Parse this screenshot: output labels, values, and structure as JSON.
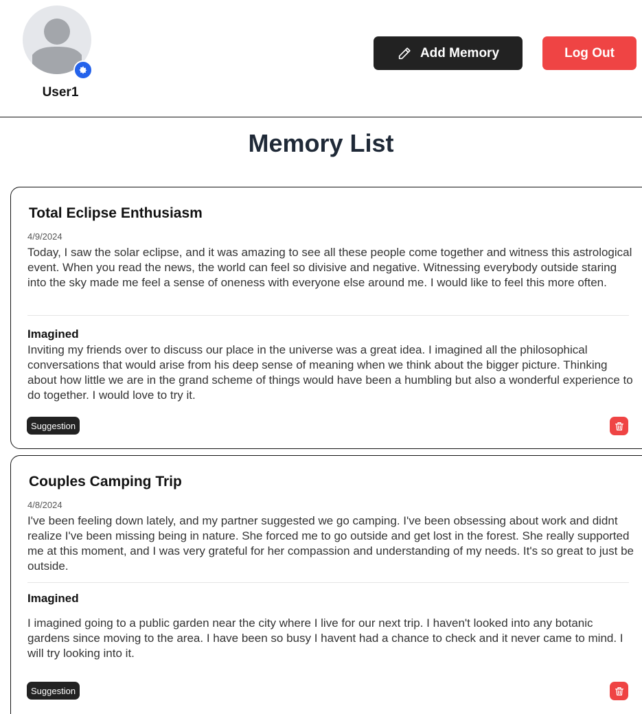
{
  "user": {
    "name": "User1"
  },
  "header": {
    "add_memory_label": "Add Memory",
    "logout_label": "Log Out"
  },
  "page": {
    "title": "Memory List"
  },
  "colors": {
    "accent_dark": "#222222",
    "danger": "#ef4444",
    "settings_badge": "#2563eb"
  },
  "memories": [
    {
      "title": "Total Eclipse Enthusiasm",
      "date": "4/9/2024",
      "text": "Today, I saw the solar eclipse, and it was amazing to see all these people come together and witness this astrological event. When you read the news, the world can feel so divisive and negative. Witnessing everybody outside staring into the sky made me feel a sense of oneness with everyone else around me. I would like to feel this more often.",
      "imagined_label": "Imagined",
      "imagined_text": "Inviting my friends over to discuss our place in the universe was a great idea. I imagined all the philosophical conversations that would arise from his deep sense of meaning when we think about the bigger picture. Thinking about how little we are in the grand scheme of things would have been a humbling but also a wonderful experience to do together. I would love to try it.",
      "tag": "Suggestion"
    },
    {
      "title": "Couples Camping Trip",
      "date": "4/8/2024",
      "text": "I've been feeling down lately, and my partner suggested we go camping. I've been obsessing about work and didnt realize I've been missing being in nature. She forced me to go outside and get lost in the forest. She really supported me at this moment, and I was very grateful for her compassion and understanding of my needs. It's so great to just be outside.",
      "imagined_label": "Imagined",
      "imagined_text": "I imagined going to a public garden near the city where I live for our next trip. I haven't looked into any botanic gardens since moving to the area. I have been so busy I havent had a chance to check and it never came to mind. I will try looking into it.",
      "tag": "Suggestion"
    }
  ],
  "icons": {
    "avatar": "user-silhouette-icon",
    "settings": "gear-icon",
    "add": "pencil-icon",
    "delete": "trash-icon"
  }
}
